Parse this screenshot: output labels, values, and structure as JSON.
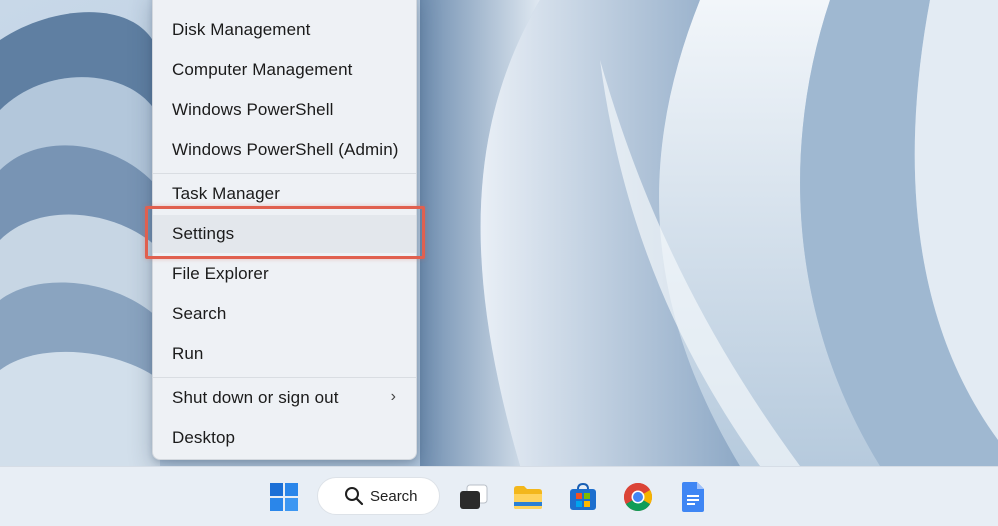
{
  "context_menu": {
    "items": [
      {
        "label": "Disk Management"
      },
      {
        "label": "Computer Management"
      },
      {
        "label": "Windows PowerShell"
      },
      {
        "label": "Windows PowerShell (Admin)"
      },
      {
        "label": "Task Manager"
      },
      {
        "label": "Settings",
        "highlighted": true
      },
      {
        "label": "File Explorer"
      },
      {
        "label": "Search"
      },
      {
        "label": "Run"
      },
      {
        "label": "Shut down or sign out",
        "submenu": true
      },
      {
        "label": "Desktop"
      }
    ],
    "submenu_glyph": "›"
  },
  "taskbar": {
    "search_label": "Search",
    "apps": [
      "windows-start-icon",
      "task-view-icon",
      "file-explorer-icon",
      "microsoft-store-icon",
      "chrome-icon",
      "google-docs-icon"
    ]
  },
  "colors": {
    "callout": "#e0604f",
    "menu_background": "#eef1f5",
    "taskbar_background": "#e8eef5",
    "windows_blue": "#1b6fd6"
  }
}
